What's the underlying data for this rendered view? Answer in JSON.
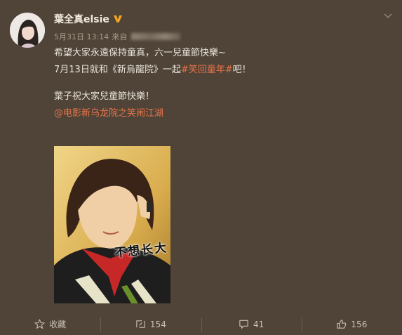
{
  "post": {
    "author": "葉全真elsie",
    "date": "5月31日 13:14",
    "source_prefix": "来自",
    "lines": {
      "l1": "希望大家永遠保持童真，六一兒童節快樂~",
      "l2_before": "7月13日就和《新烏龍院》一起",
      "l2_hashtag": "#笑回童年#",
      "l2_after": "吧！",
      "l3": "葉子祝大家兒童節快樂！",
      "l4_mention": "@电影新乌龙院之笑闹江湖"
    },
    "photo": {
      "sticker_text": "不想长大"
    }
  },
  "actions": {
    "favorite_label": "收藏",
    "repost_count": "154",
    "comment_count": "41",
    "like_count": "156"
  },
  "colors": {
    "background": "#4f4437",
    "accent": "#e8734a",
    "verified": "#f5a623"
  },
  "icons": [
    "avatar",
    "verified-badge-icon",
    "chevron-down-icon",
    "star-icon",
    "repost-icon",
    "comment-icon",
    "thumbs-up-icon"
  ]
}
